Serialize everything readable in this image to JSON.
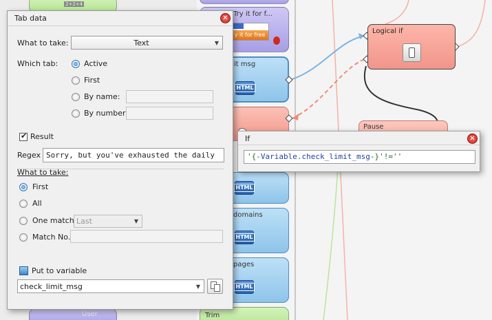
{
  "tab_data_dialog": {
    "title": "Tab data",
    "what_to_take_label": "What to take:",
    "what_to_take_value": "Text",
    "which_tab_label": "Which tab:",
    "tab_options": [
      "Active",
      "First",
      "By name:",
      "By number:"
    ],
    "selected_tab_option": "Active",
    "result_label": "Result",
    "result_checked": true,
    "regex_label": "Regex",
    "regex_value": "Sorry, but you've exhausted the daily",
    "take_section_label": "What to take:",
    "take_options": [
      "First",
      "All",
      "One match",
      "Match No."
    ],
    "selected_take_option": "First",
    "one_match_value": "Last",
    "put_to_variable_label": "Put to variable",
    "variable_value": "check_limit_msg"
  },
  "if_dialog": {
    "title": "If",
    "expr_open": "'{-",
    "expr_var": "Variable.check_limit_msg",
    "expr_close": "-}'!=''"
  },
  "canvas": {
    "blocks": {
      "try_it": "Try it for f...",
      "try_btn": "y it for free",
      "limit_msg": "it msg",
      "domains": "domains",
      "pages": "pages",
      "trim": "Trim",
      "user": "User",
      "num_label": "2+2+4",
      "logical_if": "Logical if",
      "pause": "Pause",
      "html_badge": "HTML"
    },
    "colors": {
      "purple_block": "#b9b1ee",
      "blue_block": "#a3d0f0",
      "salmon_block": "#f7a99c",
      "green_block": "#c2eaa2",
      "blue_wire": "#7ab4e0",
      "salmon_wire": "#f08a7a",
      "accent_close": "#d8342a"
    }
  }
}
